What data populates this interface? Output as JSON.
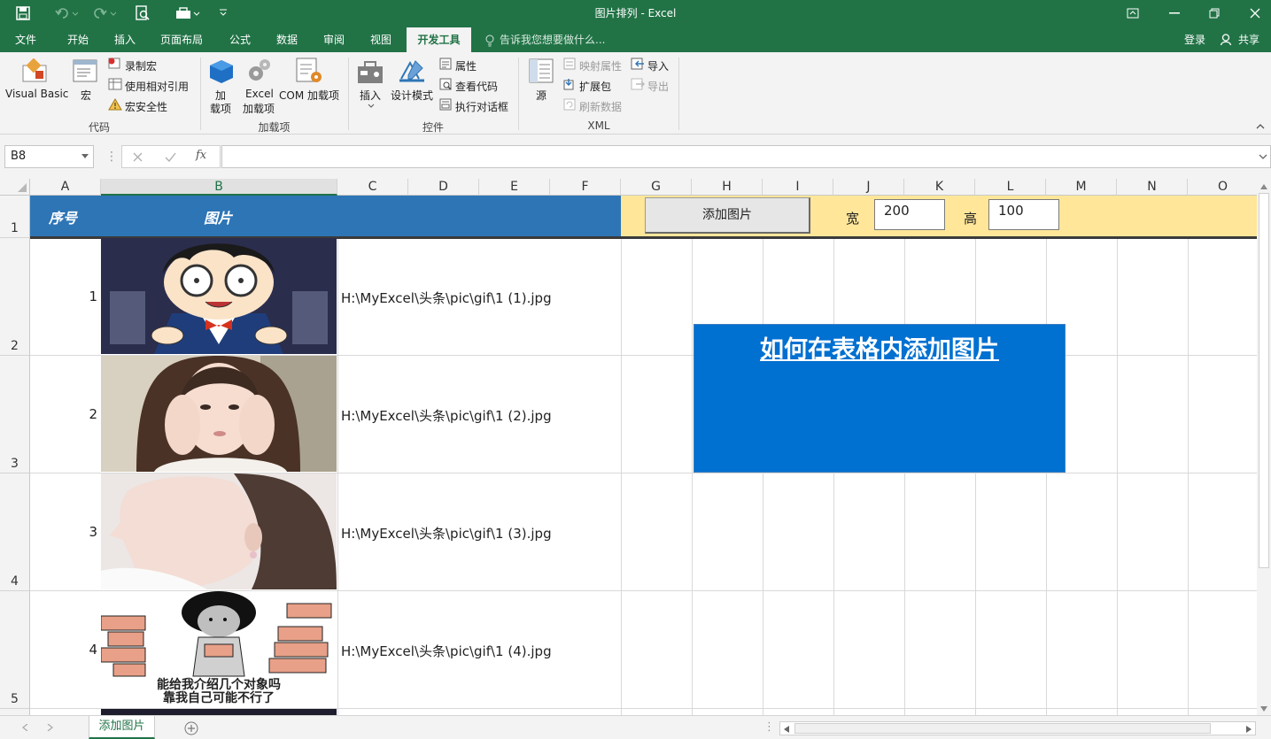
{
  "window": {
    "title": "图片排列 - Excel"
  },
  "tabs": [
    {
      "label": "文件"
    },
    {
      "label": "开始"
    },
    {
      "label": "插入"
    },
    {
      "label": "页面布局"
    },
    {
      "label": "公式"
    },
    {
      "label": "数据"
    },
    {
      "label": "审阅"
    },
    {
      "label": "视图"
    },
    {
      "label": "开发工具"
    }
  ],
  "tell_me": "告诉我您想要做什么...",
  "signin": "登录",
  "share": "共享",
  "ribbon": {
    "visual_basic": "Visual Basic",
    "macros": "宏",
    "record_macro": "录制宏",
    "relative_ref": "使用相对引用",
    "macro_security": "宏安全性",
    "group_code": "代码",
    "addins": "加\n载项",
    "addins_1": "加",
    "addins_2": "载项",
    "excel_addins_1": "Excel",
    "excel_addins_2": "加载项",
    "com_addins": "COM 加载项",
    "group_addins": "加载项",
    "insert": "插入",
    "design_mode": "设计模式",
    "properties": "属性",
    "view_code": "查看代码",
    "run_dialog": "执行对话框",
    "group_controls": "控件",
    "source": "源",
    "map_props": "映射属性",
    "expansion": "扩展包",
    "refresh": "刷新数据",
    "import": "导入",
    "export": "导出",
    "group_xml": "XML"
  },
  "namebox": "B8",
  "fx": "fx",
  "columns": [
    "A",
    "B",
    "C",
    "D",
    "E",
    "F",
    "G",
    "H",
    "I",
    "J",
    "K",
    "L",
    "M",
    "N",
    "O"
  ],
  "rows": [
    "1",
    "2",
    "3",
    "4",
    "5"
  ],
  "header_row": {
    "seq": "序号",
    "picture": "图片"
  },
  "controls": {
    "add_button": "添加图片",
    "width_label": "宽",
    "width_value": "200",
    "height_label": "高",
    "height_value": "100"
  },
  "data_rows": [
    {
      "seq": "1",
      "path": "H:\\MyExcel\\头条\\pic\\gif\\1 (1).jpg"
    },
    {
      "seq": "2",
      "path": "H:\\MyExcel\\头条\\pic\\gif\\1 (2).jpg"
    },
    {
      "seq": "3",
      "path": "H:\\MyExcel\\头条\\pic\\gif\\1 (3).jpg"
    },
    {
      "seq": "4",
      "path": "H:\\MyExcel\\头条\\pic\\gif\\1 (4).jpg"
    }
  ],
  "meme_text_1": "能给我介绍几个对象吗",
  "meme_text_2": "靠我自己可能不行了",
  "banner": "如何在表格内添加图片",
  "sheet_tab": "添加图片",
  "colors": {
    "accent": "#217346",
    "header_blue": "#2e75b6",
    "header_yellow": "#ffe699",
    "banner_blue": "#0070d1"
  }
}
